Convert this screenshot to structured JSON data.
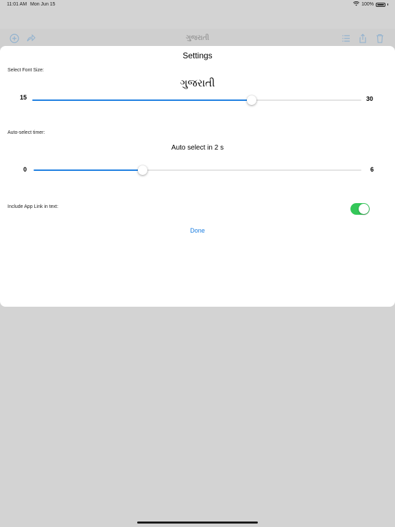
{
  "status_bar": {
    "time": "11:01 AM",
    "date": "Mon Jun 15",
    "battery": "100%"
  },
  "nav_bar": {
    "title": "ગુજરાતી",
    "icons": [
      "plus-circle-icon",
      "forward-icon",
      "list-icon",
      "share-icon",
      "trash-icon"
    ]
  },
  "settings": {
    "title": "Settings",
    "font_size": {
      "label": "Select Font Size:",
      "preview": "ગુજરાતી",
      "min": "15",
      "max": "30",
      "value": 25
    },
    "timer": {
      "label": "Auto-select timer:",
      "preview": "Auto select in 2 s",
      "min": "0",
      "max": "6",
      "value": 2
    },
    "app_link": {
      "label": "Include App Link in text:",
      "enabled": true
    },
    "done_label": "Done"
  },
  "colors": {
    "accent": "#1a7de0",
    "toggle_on": "#34c759"
  }
}
